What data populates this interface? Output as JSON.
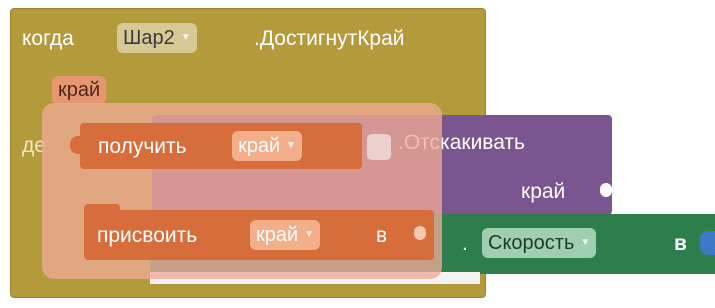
{
  "when_block": {
    "when_label": "когда",
    "component_value": "Шар2",
    "event_label": ".ДостигнутКрай",
    "param_chip": "край",
    "do_label_fragment": "де"
  },
  "bounce_block": {
    "method_label": ".Отскакивать",
    "arg_label": "край"
  },
  "get_block": {
    "label": "получить",
    "variable_value": "край"
  },
  "set_block": {
    "label": "присвоить",
    "variable_value": "край",
    "to_label": "в"
  },
  "speed_block": {
    "dot_label": ".",
    "property_value": "Скорость",
    "to_label": "в"
  },
  "colors": {
    "event_block": "#b39a3a",
    "method_block": "#7a558f",
    "variable_block": "#d66d3a",
    "setter_block": "#2e7d4d",
    "drag_overlay": "rgba(238,170,150,0.78)"
  },
  "icons": [
    "dropdown-arrow-icon"
  ]
}
